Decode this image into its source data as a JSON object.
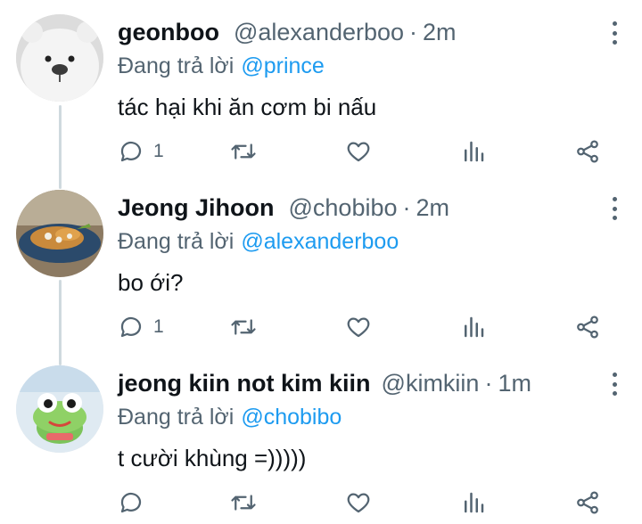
{
  "tweets": [
    {
      "display_name": "geonboo",
      "handle": "@alexanderboo",
      "separator": "·",
      "time": "2m",
      "reply_prefix": "Đang trả lời",
      "reply_to": "@prince",
      "text": "tác hại khi ăn cơm bi nấu",
      "reply_count": "1",
      "avatar_icon": "white-bear-avatar"
    },
    {
      "display_name": "Jeong Jihoon",
      "handle": "@chobibo",
      "separator": "·",
      "time": "2m",
      "reply_prefix": "Đang trả lời",
      "reply_to": "@alexanderboo",
      "text": "bo ới?",
      "reply_count": "1",
      "avatar_icon": "food-plate-avatar"
    },
    {
      "display_name": "jeong kiin not kim kiin",
      "handle": "@kimkiin",
      "separator": "·",
      "time": "1m",
      "reply_prefix": "Đang trả lời",
      "reply_to": "@chobibo",
      "text": "t cười khùng =)))))",
      "reply_count": "",
      "avatar_icon": "green-frog-avatar"
    }
  ],
  "colors": {
    "accent": "#1d9bf0",
    "secondary_text": "#536471",
    "primary_text": "#0f1419",
    "thread_line": "#cfd9de"
  },
  "icons": [
    "reply-icon",
    "retweet-icon",
    "like-icon",
    "views-icon",
    "share-icon",
    "more-options-icon"
  ]
}
